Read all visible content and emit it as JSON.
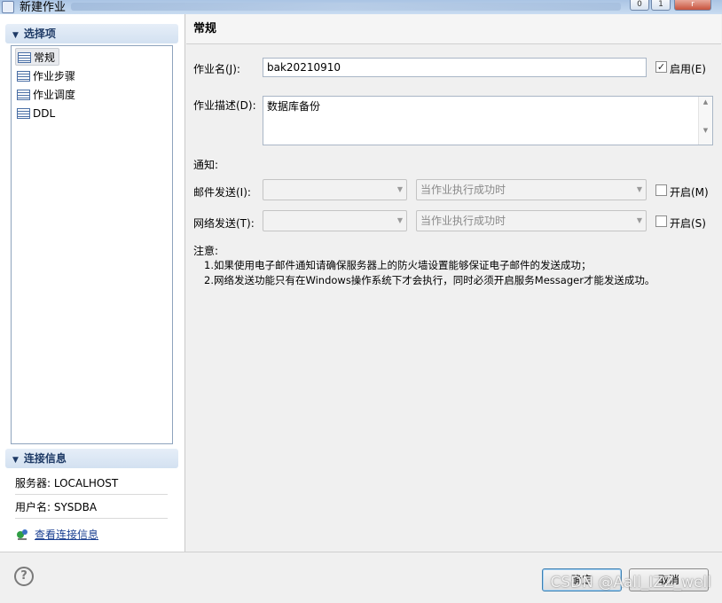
{
  "window": {
    "title": "新建作业",
    "min_label": "0",
    "max_label": "1",
    "close_label": "r"
  },
  "left": {
    "options_header": "选择项",
    "tree_items": [
      {
        "label": "常规",
        "icon": "list-icon",
        "selected": true
      },
      {
        "label": "作业步骤",
        "icon": "list-icon"
      },
      {
        "label": "作业调度",
        "icon": "list-icon"
      },
      {
        "label": "DDL",
        "icon": "list-icon"
      }
    ],
    "conn_header": "连接信息",
    "server": "服务器: LOCALHOST",
    "user": "用户名: SYSDBA",
    "view_link": "查看连接信息"
  },
  "main": {
    "section_title": "常规",
    "job_name_label": "作业名(J):",
    "job_name_value": "bak20210910",
    "enable_label": "启用(E)",
    "enable_checked": true,
    "desc_label": "作业描述(D):",
    "desc_value": "数据库备份",
    "notify_label": "通知:",
    "mail_label": "邮件发送(I):",
    "mail_target": "",
    "mail_condition": "当作业执行成功时",
    "mail_enable_label": "开启(M)",
    "net_label": "网络发送(T):",
    "net_target": "",
    "net_condition": "当作业执行成功时",
    "net_enable_label": "开启(S)",
    "note_label": "注意:",
    "note_1": "1.如果使用电子邮件通知请确保服务器上的防火墙设置能够保证电子邮件的发送成功；",
    "note_2": "2.网络发送功能只有在Windows操作系统下才会执行，同时必须开启服务Messager才能发送成功。"
  },
  "footer": {
    "help_icon": "?",
    "ok_label": "确定",
    "cancel_label": "取消",
    "watermark": "CSDN @Aall_IZZ_well"
  },
  "colors": {
    "section_header_text": "#1e3a66",
    "link": "#1a3f91"
  }
}
